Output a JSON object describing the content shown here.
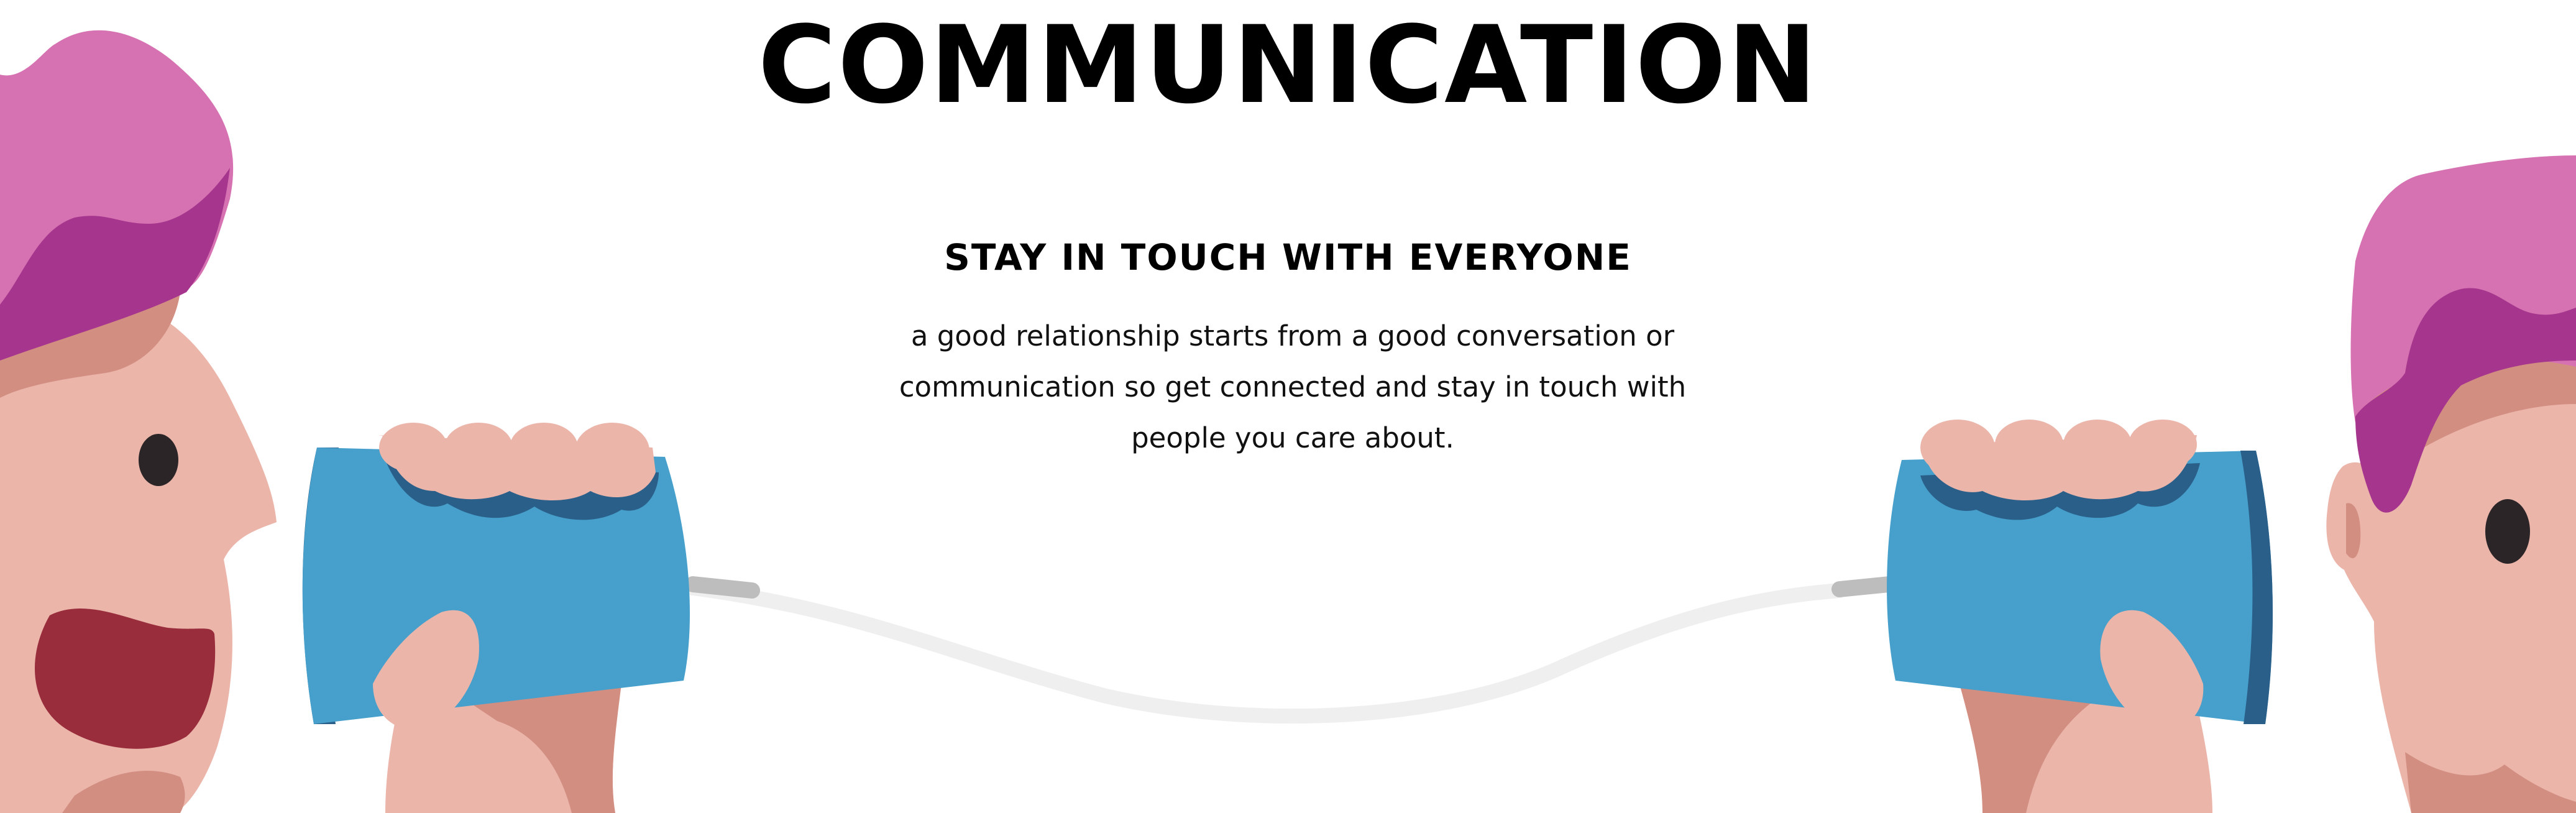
{
  "header": {
    "title": "COMMUNICATION"
  },
  "content": {
    "subtitle": "STAY IN TOUCH WITH EVERYONE",
    "description": "a good relationship starts from a good conversation or communication so get connected and stay in touch with people you care about."
  },
  "palette": {
    "hair_pink": "#d672b2",
    "hair_purple": "#a6368d",
    "skin": "#ebb5aa",
    "skin_shadow": "#d38e82",
    "can_blue": "#46a0cb",
    "can_dark": "#2a5f8a",
    "mouth": "#992d3c",
    "string": "#efefef"
  },
  "illustration": {
    "left_person": "speaking-person-icon",
    "right_person": "listening-person-icon",
    "device": "tin-can-phone-icon"
  }
}
